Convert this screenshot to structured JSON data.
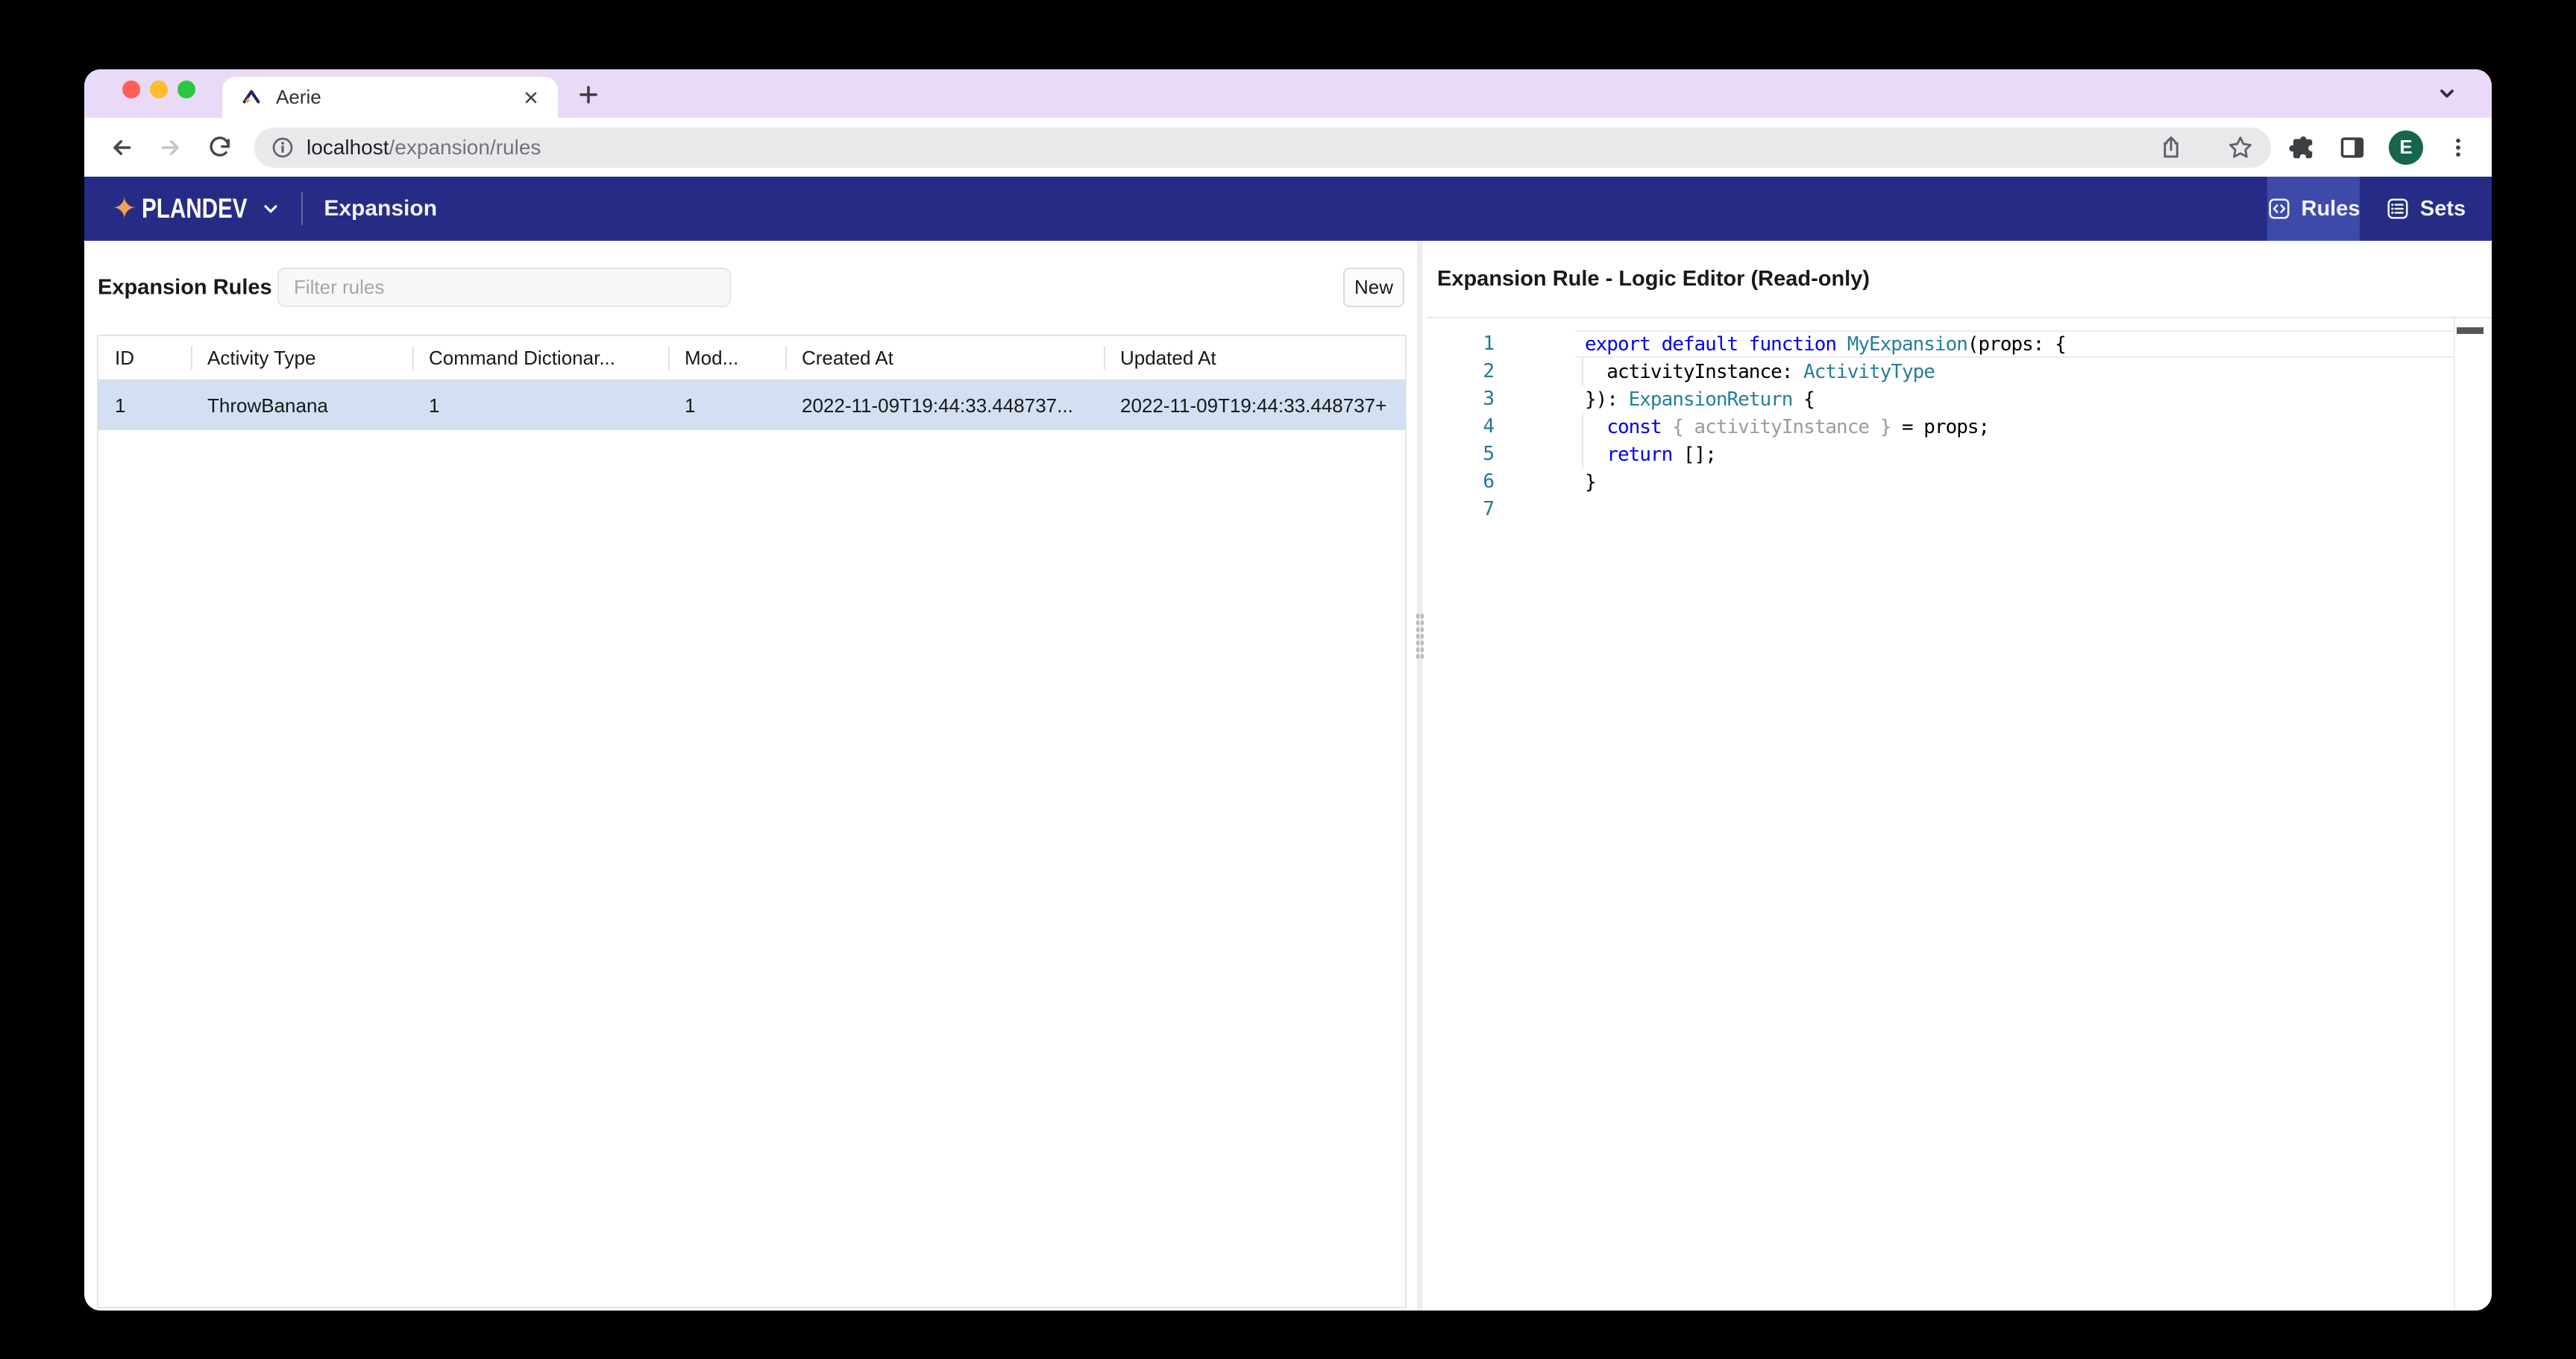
{
  "tabstrip": {
    "tab_title": "Aerie",
    "traffic_lights": [
      "close",
      "minimize",
      "zoom"
    ]
  },
  "toolbar": {
    "url_host": "localhost",
    "url_path": "/expansion/rules",
    "avatar_letter": "E"
  },
  "navbar": {
    "brand": "PLANDEV",
    "brand_star": "✦",
    "page_title": "Expansion",
    "rules_label": "Rules",
    "sets_label": "Sets"
  },
  "left_panel": {
    "title": "Expansion Rules",
    "filter_placeholder": "Filter rules",
    "new_label": "New",
    "table": {
      "columns": [
        "ID",
        "Activity Type",
        "Command Dictionar...",
        "Mod...",
        "Created At",
        "Updated At"
      ],
      "rows": [
        [
          "1",
          "ThrowBanana",
          "1",
          "1",
          "2022-11-09T19:44:33.448737...",
          "2022-11-09T19:44:33.448737+"
        ]
      ],
      "selected_row_index": 0
    }
  },
  "right_panel": {
    "title": "Expansion Rule - Logic Editor (Read-only)",
    "editor": {
      "lines": [
        {
          "n": 1,
          "current": true,
          "guide": false,
          "tokens": [
            [
              "kw",
              "export default function "
            ],
            [
              "type",
              "MyExpansion"
            ],
            [
              "plain",
              "(props: {"
            ]
          ]
        },
        {
          "n": 2,
          "current": false,
          "guide": true,
          "tokens": [
            [
              "plain",
              "  activityInstance: "
            ],
            [
              "type",
              "ActivityType"
            ]
          ]
        },
        {
          "n": 3,
          "current": false,
          "guide": false,
          "tokens": [
            [
              "plain",
              "}): "
            ],
            [
              "type",
              "ExpansionReturn"
            ],
            [
              "plain",
              " {"
            ]
          ]
        },
        {
          "n": 4,
          "current": false,
          "guide": true,
          "tokens": [
            [
              "plain",
              "  "
            ],
            [
              "kw",
              "const"
            ],
            [
              "plain",
              " "
            ],
            [
              "muted",
              "{ activityInstance }"
            ],
            [
              "plain",
              " = props;"
            ]
          ]
        },
        {
          "n": 5,
          "current": false,
          "guide": true,
          "tokens": [
            [
              "plain",
              "  "
            ],
            [
              "kw",
              "return"
            ],
            [
              "plain",
              " [];"
            ]
          ]
        },
        {
          "n": 6,
          "current": false,
          "guide": false,
          "tokens": [
            [
              "plain",
              "}"
            ]
          ]
        },
        {
          "n": 7,
          "current": false,
          "guide": false,
          "tokens": []
        }
      ]
    }
  },
  "colors": {
    "lavender": "#E9DBF7",
    "navbar": "#262C85",
    "navbar_active": "#3E4AA9",
    "accent_orange": "#F0A050",
    "selected_row": "#D3E0F1",
    "traffic_red": "#FF5F57",
    "traffic_yellow": "#FEBC2E",
    "traffic_green": "#2BC840",
    "code_keyword": "#0000EE",
    "code_type": "#267F99",
    "code_muted": "#9B9B9B",
    "line_number": "#237893",
    "avatar_green": "#166649"
  }
}
